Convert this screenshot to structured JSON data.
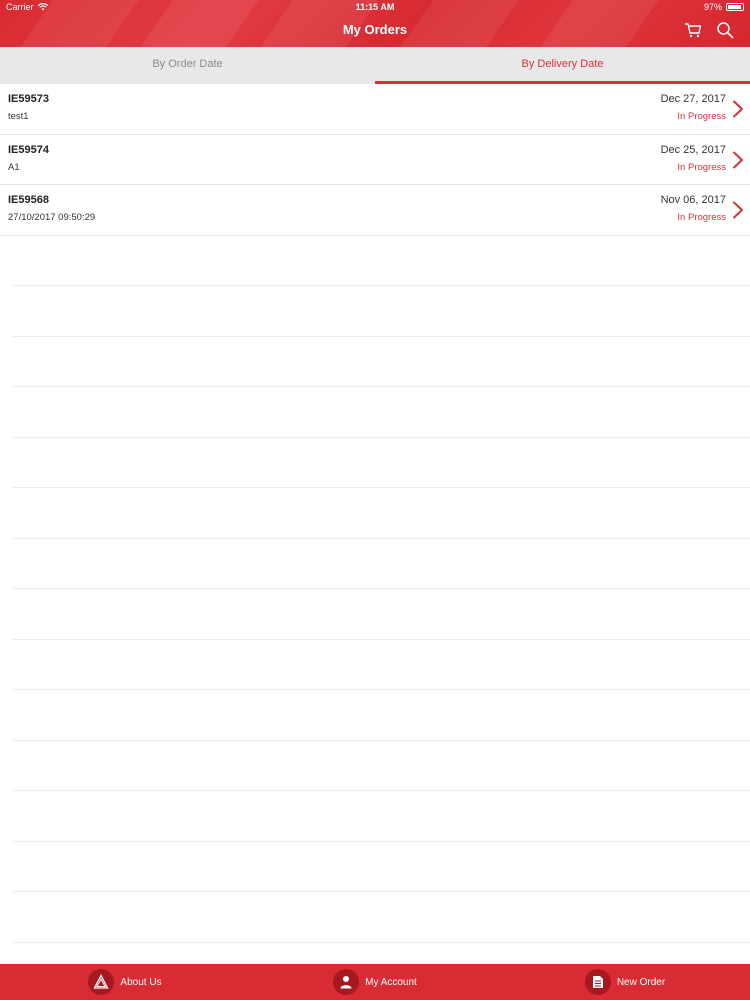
{
  "status_bar": {
    "carrier": "Carrier",
    "time": "11:15 AM",
    "battery": "97%"
  },
  "header": {
    "title": "My Orders",
    "actions": [
      {
        "icon": "cart-icon"
      },
      {
        "icon": "search-icon"
      }
    ]
  },
  "tabs": [
    {
      "label": "By Order Date",
      "active": false
    },
    {
      "label": "By Delivery Date",
      "active": true
    }
  ],
  "orders": [
    {
      "id": "IE59573",
      "note": "test1",
      "date": "Dec 27, 2017",
      "status": "In Progress"
    },
    {
      "id": "IE59574",
      "note": "A1",
      "date": "Dec 25, 2017",
      "status": "In Progress"
    },
    {
      "id": "IE59568",
      "note": "27/10/2017 09:50:29",
      "date": "Nov 06, 2017",
      "status": "In Progress"
    }
  ],
  "bottom_bar": {
    "items": [
      {
        "label": "About Us",
        "icon": "logo-icon"
      },
      {
        "label": "My Account",
        "icon": "user-icon"
      },
      {
        "label": "New Order",
        "icon": "document-icon"
      }
    ]
  },
  "colors": {
    "brand": "#d92b34",
    "accent_text": "#d6323a"
  }
}
